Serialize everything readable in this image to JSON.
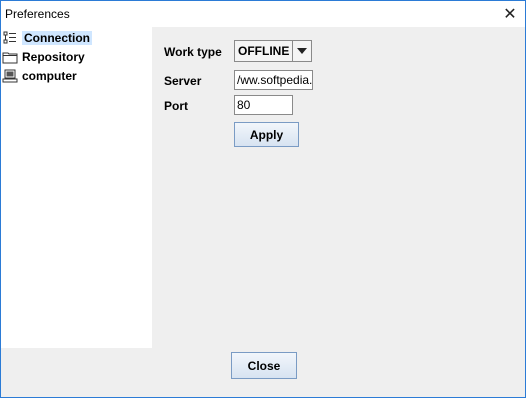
{
  "window": {
    "title": "Preferences",
    "close_glyph": "✕"
  },
  "tree": {
    "items": [
      {
        "label": "Connection",
        "icon": "list-icon",
        "selected": true
      },
      {
        "label": "Repository",
        "icon": "folder-icon",
        "selected": false
      },
      {
        "label": "computer",
        "icon": "computer-icon",
        "selected": false
      }
    ]
  },
  "form": {
    "work_type_label": "Work type",
    "work_type_value": "OFFLINE",
    "server_label": "Server",
    "server_value": "/ww.softpedia.",
    "port_label": "Port",
    "port_value": "80",
    "apply_label": "Apply"
  },
  "footer": {
    "close_label": "Close"
  }
}
